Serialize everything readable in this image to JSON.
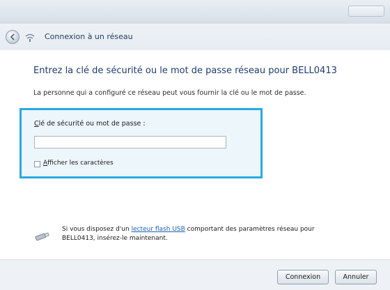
{
  "nav": {
    "title": "Connexion à un réseau",
    "icon": "network-icon"
  },
  "main": {
    "heading": "Entrez la clé de sécurité ou le mot de passe réseau pour BELL0413",
    "description": "La personne qui a configuré ce réseau peut vous fournir la clé ou le mot de passe."
  },
  "key_field": {
    "label_mnemonic": "C",
    "label_rest": "lé de sécurité ou mot de passe :",
    "value": "",
    "placeholder": ""
  },
  "show_chars": {
    "label_mnemonic": "A",
    "label_rest": "fficher les caractères",
    "checked": false
  },
  "usb": {
    "text_before": "Si vous disposez d'un ",
    "link": "lecteur flash USB",
    "text_after": " comportant des paramètres réseau pour BELL0413, insérez-le maintenant.",
    "icon": "usb-drive-icon"
  },
  "footer": {
    "connect_label": "Connexion",
    "cancel_label": "Annuler"
  },
  "colors": {
    "highlight_border": "#2aa9e0",
    "heading_text": "#1f3b73",
    "link": "#1a5fb4"
  }
}
